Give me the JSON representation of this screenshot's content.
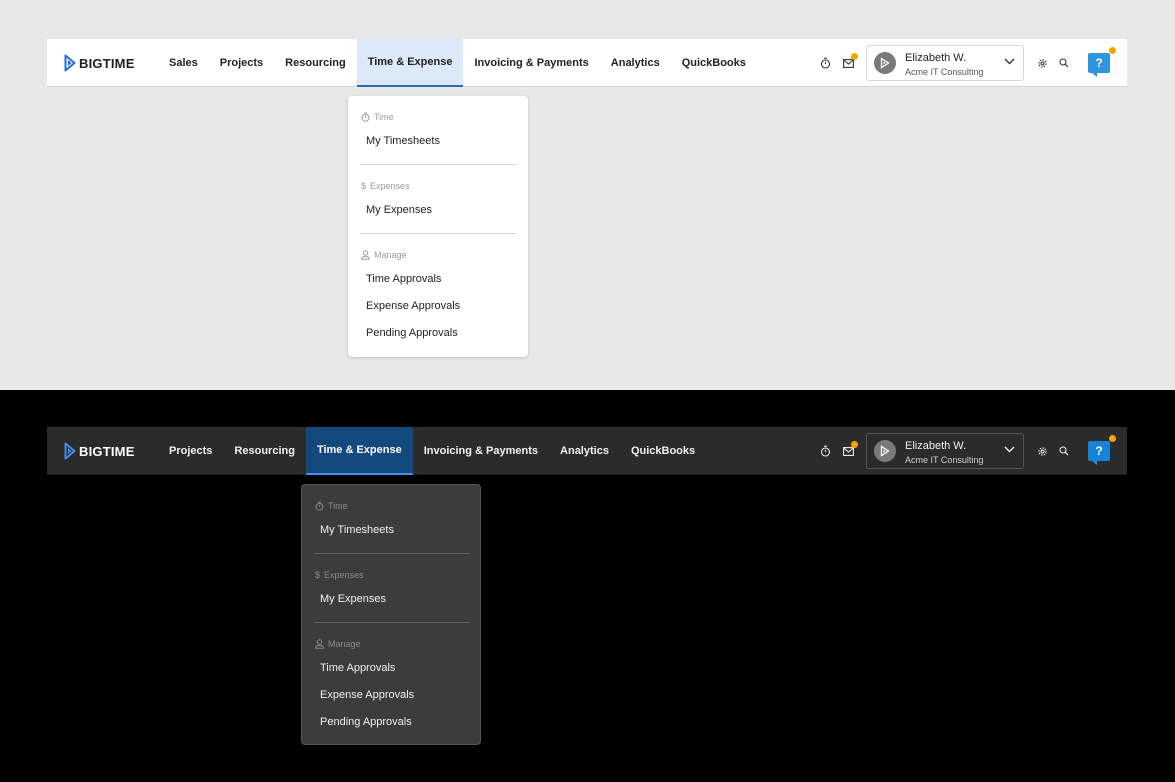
{
  "brand": {
    "logo_text": "BIGTIME",
    "accent": "#2b6cb0"
  },
  "light_panel": {
    "nav": [
      {
        "label": "Sales"
      },
      {
        "label": "Projects"
      },
      {
        "label": "Resourcing"
      },
      {
        "label": "Time & Expense",
        "active": true
      },
      {
        "label": "Invoicing & Payments"
      },
      {
        "label": "Analytics"
      },
      {
        "label": "QuickBooks"
      }
    ]
  },
  "dark_panel": {
    "nav": [
      {
        "label": "Projects"
      },
      {
        "label": "Resourcing"
      },
      {
        "label": "Time & Expense",
        "active": true
      },
      {
        "label": "Invoicing & Payments"
      },
      {
        "label": "Analytics"
      },
      {
        "label": "QuickBooks"
      }
    ]
  },
  "user": {
    "name": "Elizabeth W.",
    "company": "Acme IT Consulting"
  },
  "tools": {
    "timer_icon": "stopwatch-icon",
    "mail_icon": "mail-icon",
    "settings_icon": "gear-icon",
    "search_icon": "search-icon",
    "help_label": "?"
  },
  "dropdown": {
    "time_title": "Time",
    "my_timesheets": "My Timesheets",
    "expenses_title": "Expenses",
    "my_expenses": "My Expenses",
    "manage_title": "Manage",
    "time_approvals": "Time Approvals",
    "expense_approvals": "Expense Approvals",
    "pending_approvals": "Pending Approvals"
  },
  "colors": {
    "notification": "#f5a300",
    "help": "#1d8fe0"
  }
}
